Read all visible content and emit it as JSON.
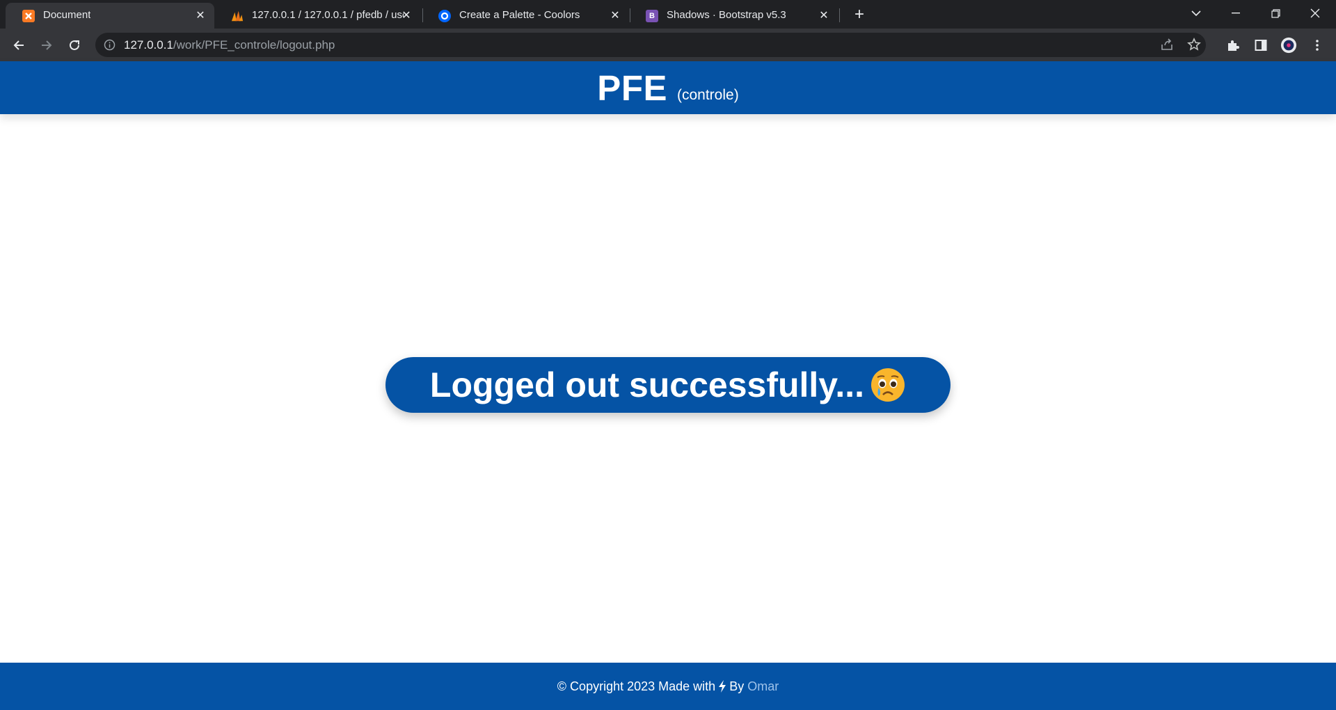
{
  "browser": {
    "tabs": [
      {
        "title": "Document",
        "favicon": "xampp-icon",
        "favicon_color": "#fb7a24",
        "active": true
      },
      {
        "title": "127.0.0.1 / 127.0.0.1 / pfedb / use",
        "favicon": "phpmyadmin-icon",
        "favicon_color": "#f29111",
        "active": false
      },
      {
        "title": "Create a Palette - Coolors",
        "favicon": "coolors-icon",
        "favicon_color": "#0066ff",
        "active": false
      },
      {
        "title": "Shadows · Bootstrap v5.3",
        "favicon": "bootstrap-icon",
        "favicon_color": "#7952b3",
        "active": false
      }
    ],
    "address": {
      "host": "127.0.0.1",
      "path": "/work/PFE_controle/logout.php"
    }
  },
  "header": {
    "brand": "PFE",
    "brand_sub": "(controle)"
  },
  "main": {
    "message": "Logged out successfully...",
    "emoji": "crying-face-icon"
  },
  "footer": {
    "text": "© Copyright 2023 Made with",
    "icon": "lightning-bolt-icon",
    "by": "By",
    "author": "Omar"
  },
  "colors": {
    "brand": "#0553a5",
    "footer_link": "#9fc3ea"
  }
}
